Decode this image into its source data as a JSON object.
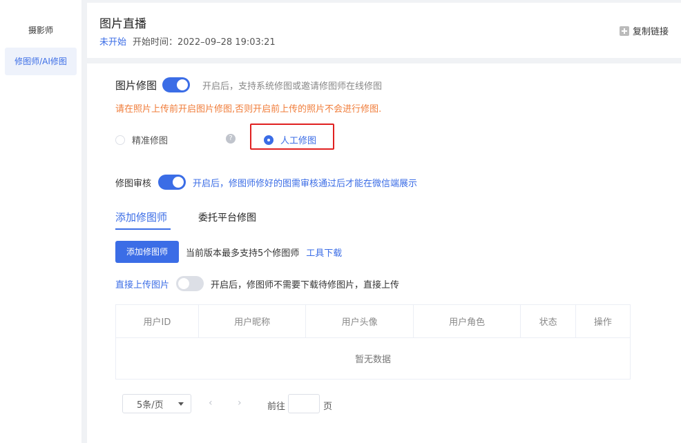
{
  "sidebar": {
    "items": [
      {
        "label": "摄影师"
      },
      {
        "label": "修图师/AI修图"
      }
    ]
  },
  "header": {
    "title": "图片直播",
    "status": "未开始",
    "start_time": "开始时间：2022–09–28 19:03:21",
    "copy_link": "复制链接"
  },
  "retouch": {
    "label": "图片修图",
    "switch_on": true,
    "desc": "开启后，支持系统修图或邀请修图师在线修图",
    "warning": "请在照片上传前开启图片修图,否则开启前上传的照片不会进行修图.",
    "options": [
      {
        "label": "精准修图",
        "checked": false
      },
      {
        "label": "人工修图",
        "checked": true
      }
    ]
  },
  "review": {
    "label": "修图审核",
    "switch_on": true,
    "desc": "开启后，修图师修好的图需审核通过后才能在微信端展示"
  },
  "tabs": [
    {
      "label": "添加修图师",
      "active": true
    },
    {
      "label": "委托平台修图",
      "active": false
    }
  ],
  "add_row": {
    "button": "添加修图师",
    "note": "当前版本最多支持5个修图师",
    "link": "工具下载"
  },
  "direct_upload": {
    "label": "直接上传图片",
    "switch_on": false,
    "desc": "开启后，修图师不需要下载待修图片，直接上传"
  },
  "table": {
    "columns": [
      "用户ID",
      "用户昵称",
      "用户头像",
      "用户角色",
      "状态",
      "操作"
    ],
    "empty_text": "暂无数据"
  },
  "pagination": {
    "page_size": "5条/页",
    "prev": "‹",
    "next": "›",
    "goto_label": "前往",
    "page_label": "页"
  },
  "colors": {
    "accent": "#3b6de6",
    "warning": "#f07c39",
    "highlight": "#e02020"
  }
}
